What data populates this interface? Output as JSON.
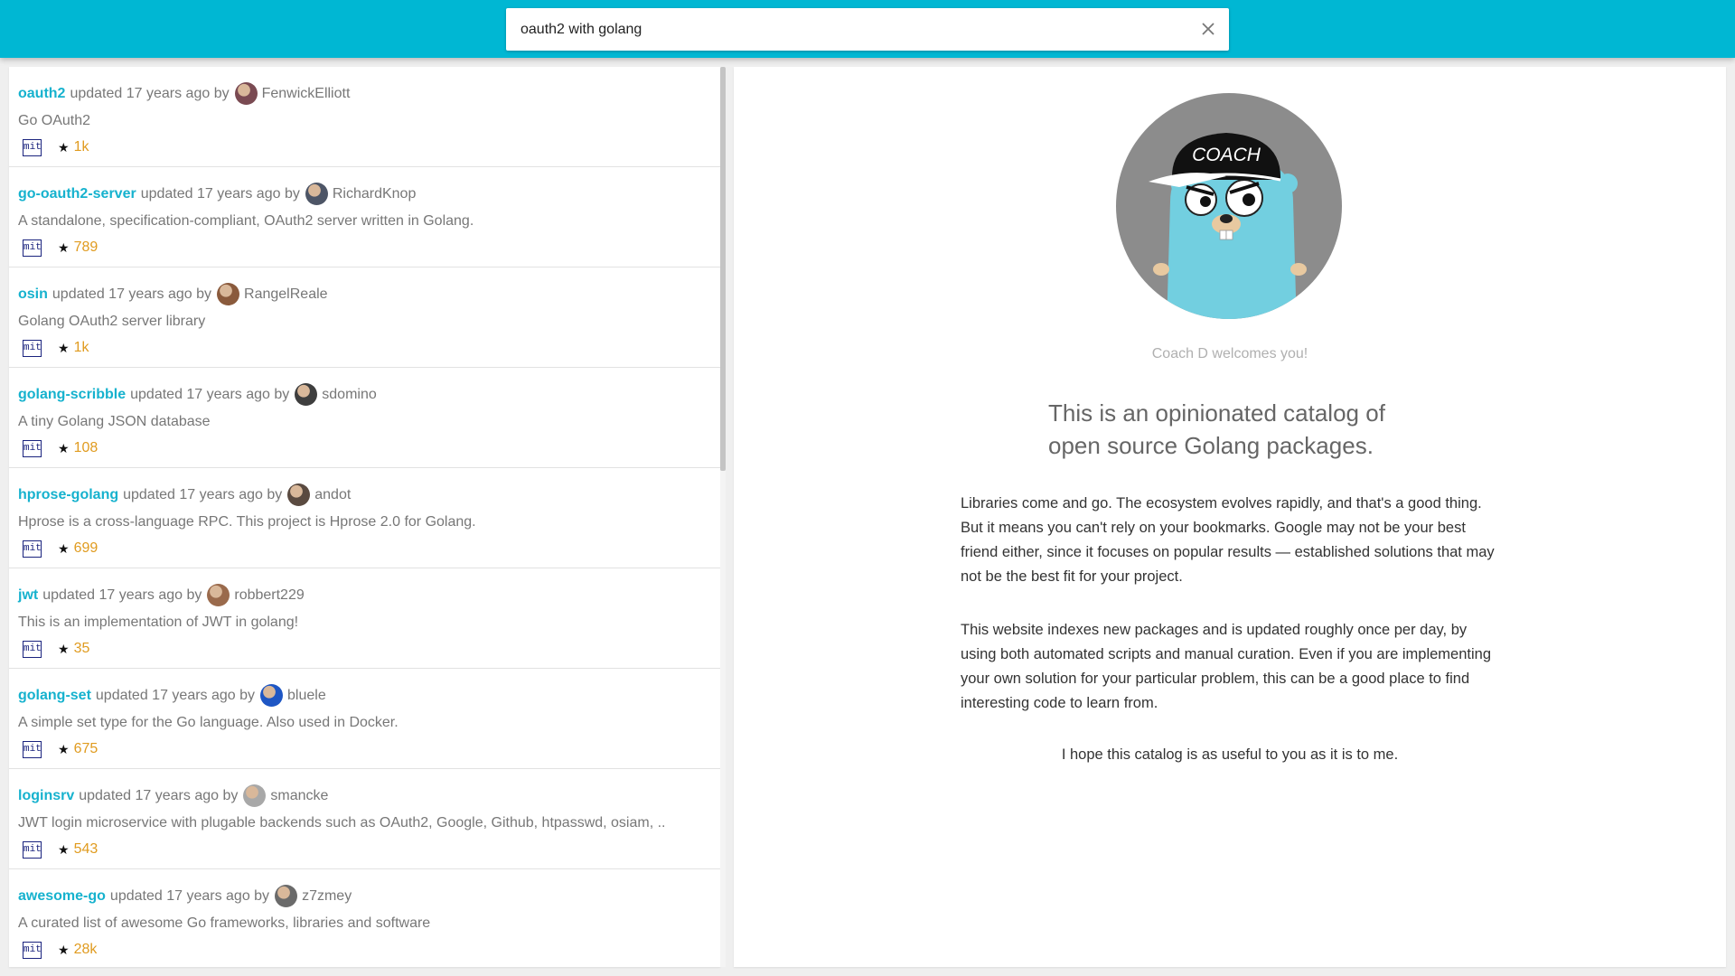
{
  "search": {
    "value": "oauth2 with golang",
    "placeholder": ""
  },
  "results": [
    {
      "name": "oauth2",
      "updated": "updated 17 years ago by",
      "author": "FenwickElliott",
      "description": "Go OAuth2",
      "license": "mit",
      "stars": "1k",
      "avatar_color": "#7a4a52"
    },
    {
      "name": "go-oauth2-server",
      "updated": "updated 17 years ago by",
      "author": "RichardKnop",
      "description": "A standalone, specification-compliant, OAuth2 server written in Golang.",
      "license": "mit",
      "stars": "789",
      "avatar_color": "#4d5566"
    },
    {
      "name": "osin",
      "updated": "updated 17 years ago by",
      "author": "RangelReale",
      "description": "Golang OAuth2 server library",
      "license": "mit",
      "stars": "1k",
      "avatar_color": "#8a5a3c"
    },
    {
      "name": "golang-scribble",
      "updated": "updated 17 years ago by",
      "author": "sdomino",
      "description": "A tiny Golang JSON database",
      "license": "mit",
      "stars": "108",
      "avatar_color": "#3e3e3e"
    },
    {
      "name": "hprose-golang",
      "updated": "updated 17 years ago by",
      "author": "andot",
      "description": "Hprose is a cross-language RPC. This project is Hprose 2.0 for Golang.",
      "license": "mit",
      "stars": "699",
      "avatar_color": "#5a4a40"
    },
    {
      "name": "jwt",
      "updated": "updated 17 years ago by",
      "author": "robbert229",
      "description": "This is an implementation of JWT in golang!",
      "license": "mit",
      "stars": "35",
      "avatar_color": "#9a6a4c"
    },
    {
      "name": "golang-set",
      "updated": "updated 17 years ago by",
      "author": "bluele",
      "description": "A simple set type for the Go language. Also used in Docker.",
      "license": "mit",
      "stars": "675",
      "avatar_color": "#1e56c4"
    },
    {
      "name": "loginsrv",
      "updated": "updated 17 years ago by",
      "author": "smancke",
      "description": "JWT login microservice with plugable backends such as OAuth2, Google, Github, htpasswd, osiam, ..",
      "license": "mit",
      "stars": "543",
      "avatar_color": "#a8a8a8"
    },
    {
      "name": "awesome-go",
      "updated": "updated 17 years ago by",
      "author": "z7zmey",
      "description": "A curated list of awesome Go frameworks, libraries and software",
      "license": "mit",
      "stars": "28k",
      "avatar_color": "#6a6a6a"
    }
  ],
  "welcome": {
    "mascot_cap_text": "COACH",
    "caption": "Coach D welcomes you!",
    "tagline": "This is an opinionated catalog of open source Golang packages.",
    "paragraph1": "Libraries come and go. The ecosystem evolves rapidly, and that's a good thing. But it means you can't rely on your bookmarks. Google may not be your best friend either, since it focuses on popular results — established solutions that may not be the best fit for your project.",
    "paragraph2": "This website indexes new packages and is updated roughly once per day, by using both automated scripts and manual curation. Even if you are implementing your own solution for your particular problem, this can be a good place to find interesting code to learn from.",
    "closing": "I hope this catalog is as useful to you as it is to me."
  },
  "icons": {
    "clear": "close-icon",
    "star": "star-icon",
    "mascot": "gopher-mascot"
  },
  "colors": {
    "header": "#00b7d3",
    "link": "#16b2ce",
    "stars": "#e09b1f",
    "license": "#1a237e"
  }
}
